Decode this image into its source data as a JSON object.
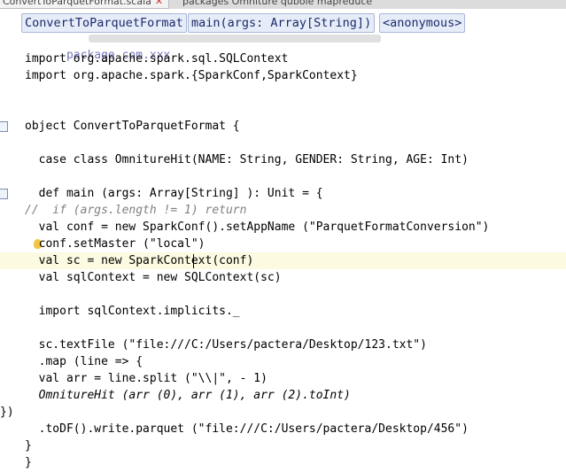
{
  "tabs": [
    {
      "label": "ConvertToParquetFormat.scala",
      "active": true
    },
    {
      "label": "packages Omniture qubole mapreduce",
      "active": false
    }
  ],
  "breadcrumbs": [
    "ConvertToParquetFormat",
    "main(args: Array[String])",
    "<anonymous>"
  ],
  "code_lines": [
    "package com.xxx",
    "import org.apache.spark.sql.SQLContext",
    "import org.apache.spark.{SparkConf,SparkContext}",
    "",
    "",
    "object ConvertToParquetFormat {",
    "",
    "  case class OmnitureHit(NAME: String, GENDER: String, AGE: Int)",
    "",
    "  def main (args: Array[String] ): Unit = {",
    "//  if (args.length != 1) return",
    "  val conf = new SparkConf().setAppName (\"ParquetFormatConversion\")",
    "  conf.setMaster (\"local\")",
    "  val sc = new SparkContext(conf)",
    "  val sqlContext = new SQLContext(sc)",
    "",
    "  import sqlContext.implicits._",
    "",
    "  sc.textFile (\"file:///C:/Users/pactera/Desktop/123.txt\")",
    "  .map (line => {",
    "  val arr = line.split (\"\\\\|\", - 1)",
    "  OmnitureHit (arr (0), arr (1), arr (2).toInt)",
    "})",
    "  .toDF().write.parquet (\"file:///C:/Users/pactera/Desktop/456\")",
    "}",
    "}"
  ],
  "colors": {
    "keyword": "#000080",
    "type": "#20999d",
    "string": "#008000",
    "comment": "#808080",
    "current_line": "#fcfae1"
  },
  "icons": [
    "fold-marker-icon",
    "intention-bulb-icon",
    "close-icon"
  ]
}
